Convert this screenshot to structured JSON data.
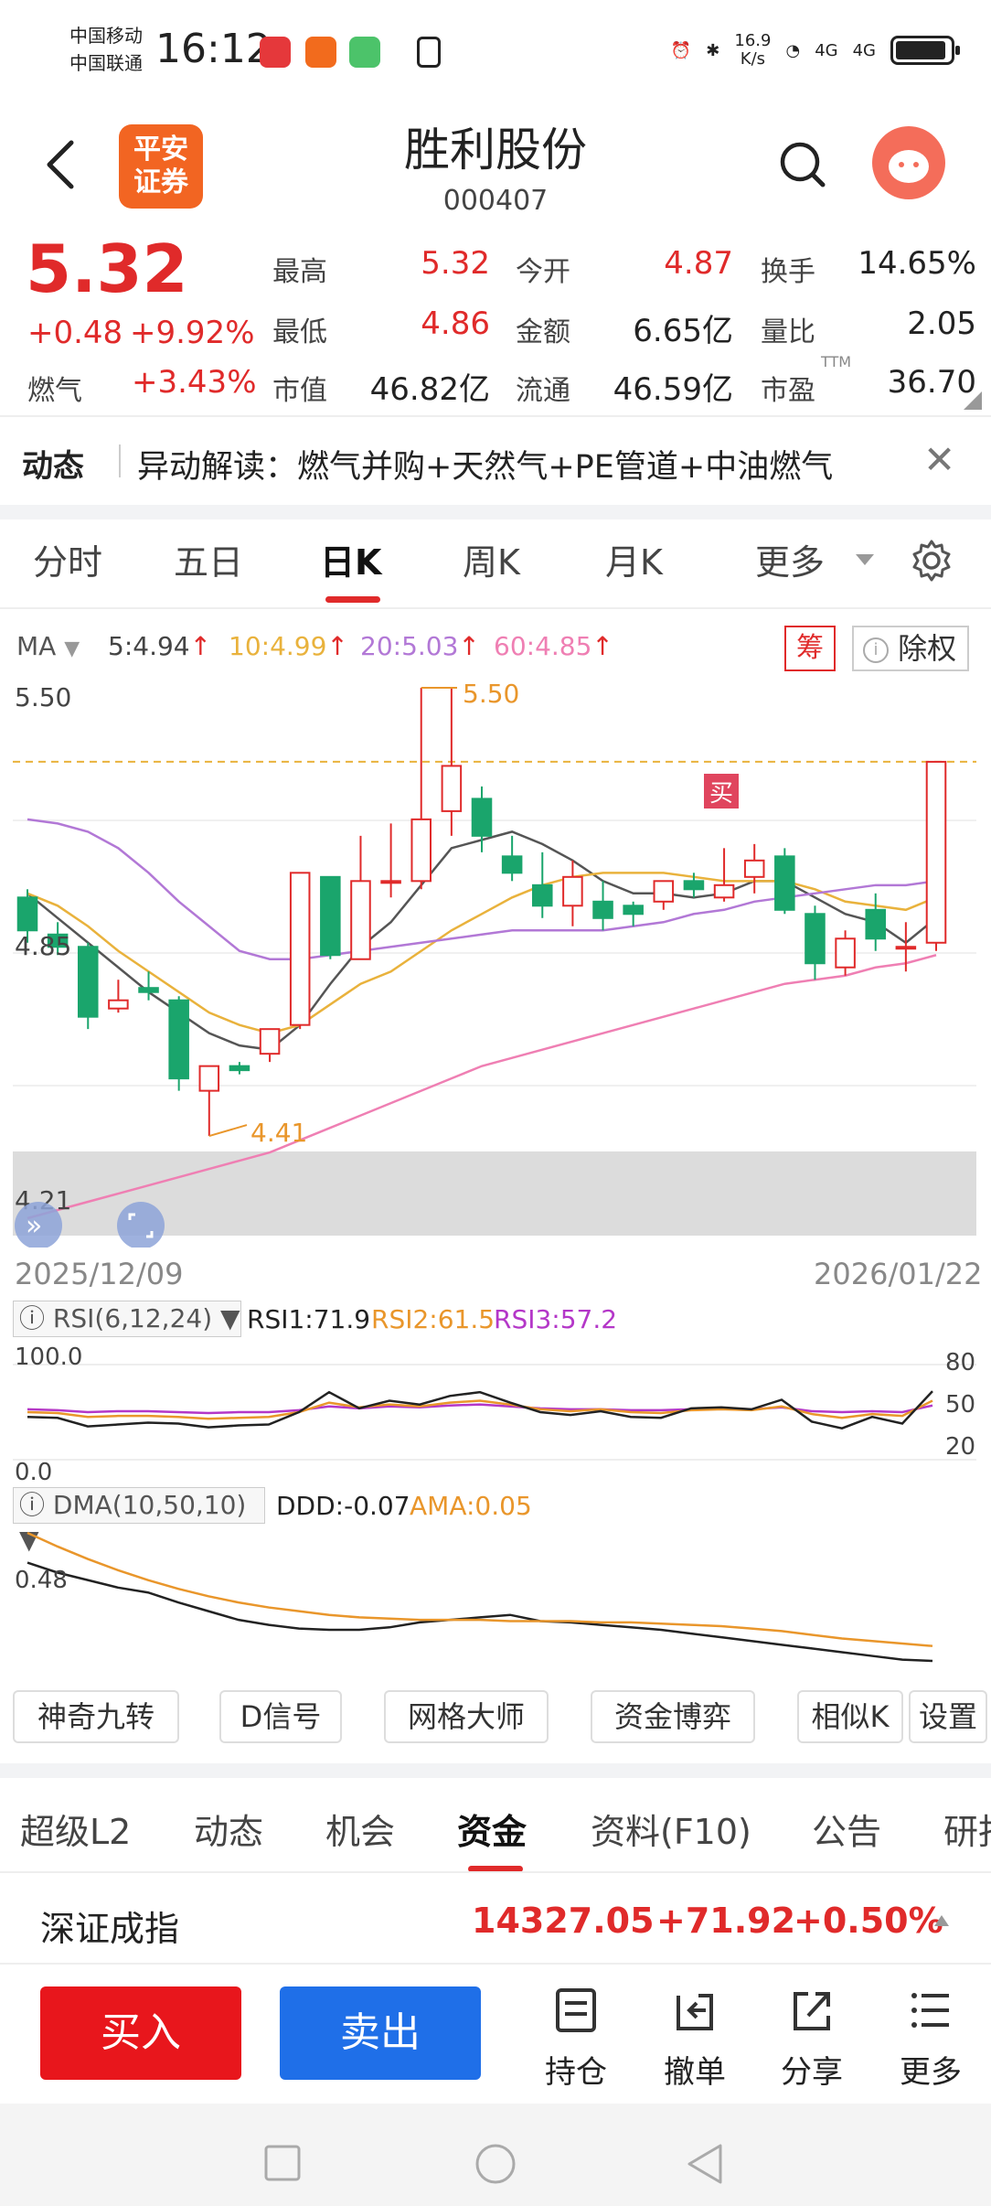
{
  "status_bar": {
    "carrier1": "中国移动",
    "carrier2": "中国联通",
    "time": "16:12",
    "net_speed_value": "16.9",
    "net_speed_unit": "K/s",
    "net1": "4G",
    "net2": "4G"
  },
  "header": {
    "logo_line1": "平安",
    "logo_line2": "证券",
    "stock_name": "胜利股份",
    "stock_code": "000407"
  },
  "quote": {
    "price": "5.32",
    "change": "+0.48",
    "change_pct": "+9.92%",
    "sector": "燃气",
    "sector_change": "+3.43%",
    "high_label": "最高",
    "high": "5.32",
    "open_label": "今开",
    "open": "4.87",
    "turnover_label": "换手",
    "turnover": "14.65%",
    "low_label": "最低",
    "low": "4.86",
    "amount_label": "金额",
    "amount": "6.65亿",
    "vol_ratio_label": "量比",
    "vol_ratio": "2.05",
    "mktcap_label": "市值",
    "mktcap": "46.82亿",
    "float_label": "流通",
    "float_cap": "46.59亿",
    "pe_label": "市盈",
    "pe_sup": "TTM",
    "pe": "36.70"
  },
  "news": {
    "tag": "动态",
    "text": "异动解读：燃气并购+天然气+PE管道+中油燃气"
  },
  "chart_tabs": [
    "分时",
    "五日",
    "日K",
    "周K",
    "月K",
    "更多"
  ],
  "ma_legend": {
    "label": "MA",
    "ma5": "5:4.94",
    "ma10": "10:4.99",
    "ma20": "20:5.03",
    "ma60": "60:4.85",
    "chou": "筹",
    "chuquan": "除权"
  },
  "chart_data": [
    {
      "type": "candlestick",
      "x_start": "2025/12/09",
      "x_end": "2026/01/22",
      "y_ticks": [
        "5.50",
        "4.85",
        "4.21"
      ],
      "ylim": [
        4.21,
        5.5
      ],
      "annotations": [
        "5.50",
        "4.41",
        "买"
      ],
      "candles": [
        {
          "o": 4.99,
          "h": 5.01,
          "l": 4.88,
          "c": 4.91
        },
        {
          "o": 4.9,
          "h": 4.93,
          "l": 4.85,
          "c": 4.87
        },
        {
          "o": 4.87,
          "h": 4.88,
          "l": 4.67,
          "c": 4.7
        },
        {
          "o": 4.72,
          "h": 4.79,
          "l": 4.71,
          "c": 4.74
        },
        {
          "o": 4.77,
          "h": 4.81,
          "l": 4.74,
          "c": 4.76
        },
        {
          "o": 4.74,
          "h": 4.75,
          "l": 4.52,
          "c": 4.55
        },
        {
          "o": 4.52,
          "h": 4.58,
          "l": 4.41,
          "c": 4.58
        },
        {
          "o": 4.58,
          "h": 4.59,
          "l": 4.56,
          "c": 4.57
        },
        {
          "o": 4.61,
          "h": 4.67,
          "l": 4.59,
          "c": 4.67
        },
        {
          "o": 4.68,
          "h": 5.05,
          "l": 4.67,
          "c": 5.05
        },
        {
          "o": 5.04,
          "h": 5.04,
          "l": 4.84,
          "c": 4.85
        },
        {
          "o": 4.84,
          "h": 5.14,
          "l": 4.84,
          "c": 5.03
        },
        {
          "o": 5.03,
          "h": 5.17,
          "l": 4.99,
          "c": 5.03
        },
        {
          "o": 5.03,
          "h": 5.5,
          "l": 5.01,
          "c": 5.18
        },
        {
          "o": 5.2,
          "h": 5.5,
          "l": 5.14,
          "c": 5.31
        },
        {
          "o": 5.23,
          "h": 5.26,
          "l": 5.1,
          "c": 5.14
        },
        {
          "o": 5.09,
          "h": 5.14,
          "l": 5.03,
          "c": 5.05
        },
        {
          "o": 5.02,
          "h": 5.1,
          "l": 4.94,
          "c": 4.97
        },
        {
          "o": 4.97,
          "h": 5.08,
          "l": 4.92,
          "c": 5.04
        },
        {
          "o": 4.98,
          "h": 5.03,
          "l": 4.91,
          "c": 4.94
        },
        {
          "o": 4.97,
          "h": 4.98,
          "l": 4.92,
          "c": 4.95
        },
        {
          "o": 4.98,
          "h": 5.03,
          "l": 4.96,
          "c": 5.03
        },
        {
          "o": 5.03,
          "h": 5.05,
          "l": 4.99,
          "c": 5.01
        },
        {
          "o": 4.99,
          "h": 5.11,
          "l": 4.98,
          "c": 5.02
        },
        {
          "o": 5.04,
          "h": 5.12,
          "l": 5.0,
          "c": 5.08
        },
        {
          "o": 5.09,
          "h": 5.11,
          "l": 4.95,
          "c": 4.96
        },
        {
          "o": 4.95,
          "h": 4.97,
          "l": 4.79,
          "c": 4.83
        },
        {
          "o": 4.82,
          "h": 4.91,
          "l": 4.8,
          "c": 4.89
        },
        {
          "o": 4.96,
          "h": 5.0,
          "l": 4.86,
          "c": 4.89
        },
        {
          "o": 4.87,
          "h": 4.93,
          "l": 4.81,
          "c": 4.87
        },
        {
          "o": 4.88,
          "h": 5.32,
          "l": 4.86,
          "c": 5.32
        }
      ],
      "series": [
        {
          "name": "5",
          "color": "#555555",
          "values": [
            5.0,
            4.94,
            4.88,
            4.82,
            4.76,
            4.71,
            4.66,
            4.63,
            4.62,
            4.68,
            4.78,
            4.87,
            4.93,
            5.02,
            5.11,
            5.13,
            5.15,
            5.12,
            5.08,
            5.03,
            5.0,
            5.0,
            4.99,
            5.0,
            5.03,
            5.03,
            4.99,
            4.95,
            4.93,
            4.88,
            4.94
          ]
        },
        {
          "name": "10",
          "color": "#e9b23c",
          "values": [
            5.0,
            4.97,
            4.92,
            4.86,
            4.81,
            4.76,
            4.71,
            4.68,
            4.66,
            4.68,
            4.73,
            4.78,
            4.81,
            4.86,
            4.91,
            4.95,
            4.99,
            5.02,
            5.04,
            5.05,
            5.05,
            5.05,
            5.04,
            5.03,
            5.03,
            5.03,
            5.01,
            4.98,
            4.97,
            4.96,
            4.99
          ]
        },
        {
          "name": "20",
          "color": "#b278d6",
          "values": [
            5.18,
            5.17,
            5.15,
            5.11,
            5.05,
            4.98,
            4.92,
            4.86,
            4.84,
            4.84,
            4.85,
            4.86,
            4.87,
            4.88,
            4.89,
            4.9,
            4.91,
            4.91,
            4.91,
            4.91,
            4.92,
            4.93,
            4.95,
            4.96,
            4.98,
            4.99,
            5.0,
            5.01,
            5.02,
            5.02,
            5.03
          ]
        },
        {
          "name": "60",
          "color": "#ef7fb3",
          "values": [
            4.21,
            4.23,
            4.25,
            4.27,
            4.29,
            4.31,
            4.33,
            4.35,
            4.37,
            4.4,
            4.43,
            4.46,
            4.49,
            4.52,
            4.55,
            4.58,
            4.6,
            4.62,
            4.64,
            4.66,
            4.68,
            4.7,
            4.72,
            4.74,
            4.76,
            4.78,
            4.79,
            4.8,
            4.82,
            4.83,
            4.85
          ]
        }
      ]
    },
    {
      "type": "line",
      "ylim": [
        0.0,
        100.0
      ],
      "y_ticks": [
        "100.0",
        "0.0"
      ],
      "right_ticks": [
        "80",
        "50",
        "20"
      ],
      "series": [
        {
          "name": "RSI1",
          "color": "#222222",
          "values": [
            45,
            44,
            35,
            37,
            39,
            38,
            34,
            36,
            37,
            50,
            71,
            54,
            62,
            58,
            67,
            71,
            60,
            50,
            47,
            51,
            45,
            44,
            54,
            55,
            53,
            63,
            40,
            33,
            45,
            38,
            72
          ]
        },
        {
          "name": "RSI2",
          "color": "#e9962b",
          "values": [
            50,
            49,
            45,
            46,
            46,
            45,
            43,
            44,
            45,
            50,
            60,
            55,
            58,
            56,
            60,
            62,
            58,
            53,
            51,
            53,
            50,
            49,
            52,
            53,
            52,
            56,
            48,
            44,
            48,
            46,
            62
          ]
        },
        {
          "name": "RSI3",
          "color": "#b437c8",
          "values": [
            53,
            52,
            50,
            51,
            51,
            50,
            49,
            50,
            50,
            52,
            56,
            54,
            56,
            55,
            57,
            58,
            56,
            54,
            53,
            53,
            52,
            52,
            53,
            54,
            53,
            55,
            51,
            50,
            51,
            50,
            57
          ]
        }
      ]
    },
    {
      "type": "line",
      "y_ticks": [
        "0.48"
      ],
      "series": [
        {
          "name": "DDD",
          "color": "#222222",
          "values": [
            0.72,
            0.64,
            0.58,
            0.52,
            0.48,
            0.4,
            0.33,
            0.26,
            0.22,
            0.19,
            0.18,
            0.18,
            0.2,
            0.24,
            0.26,
            0.28,
            0.3,
            0.25,
            0.24,
            0.22,
            0.2,
            0.18,
            0.15,
            0.12,
            0.09,
            0.06,
            0.03,
            0.0,
            -0.03,
            -0.06,
            -0.07
          ]
        },
        {
          "name": "AMA",
          "color": "#e9962b",
          "values": [
            0.96,
            0.85,
            0.75,
            0.66,
            0.58,
            0.51,
            0.45,
            0.4,
            0.36,
            0.33,
            0.3,
            0.28,
            0.27,
            0.26,
            0.26,
            0.26,
            0.25,
            0.25,
            0.25,
            0.24,
            0.24,
            0.23,
            0.22,
            0.21,
            0.19,
            0.17,
            0.14,
            0.11,
            0.09,
            0.07,
            0.05
          ]
        }
      ]
    }
  ],
  "indicators": {
    "rsi_label": "RSI(6,12,24)",
    "rsi1": "RSI1:71.9",
    "rsi2": "RSI2:61.5",
    "rsi3": "RSI3:57.2",
    "dma_label": "DMA(10,50,10)",
    "ddd": "DDD:-0.07",
    "ama": "AMA:0.05"
  },
  "tools": [
    "神奇九转",
    "D信号",
    "网格大师",
    "资金博弈",
    "相似K",
    "设置"
  ],
  "bottom_tabs": [
    "超级L2",
    "动态",
    "机会",
    "资金",
    "资料(F10)",
    "公告",
    "研报"
  ],
  "index_row": {
    "name": "深证成指",
    "value": "14327.05",
    "change": "+71.92",
    "change_pct": "+0.50%"
  },
  "actions": {
    "buy": "买入",
    "sell": "卖出",
    "holdings": "持仓",
    "cancel": "撤单",
    "share": "分享",
    "more": "更多"
  },
  "colors": {
    "up": "#e02a2a",
    "down": "#1aa56c",
    "accent": "#e02a2a",
    "sell_blue": "#1f6fe8"
  }
}
